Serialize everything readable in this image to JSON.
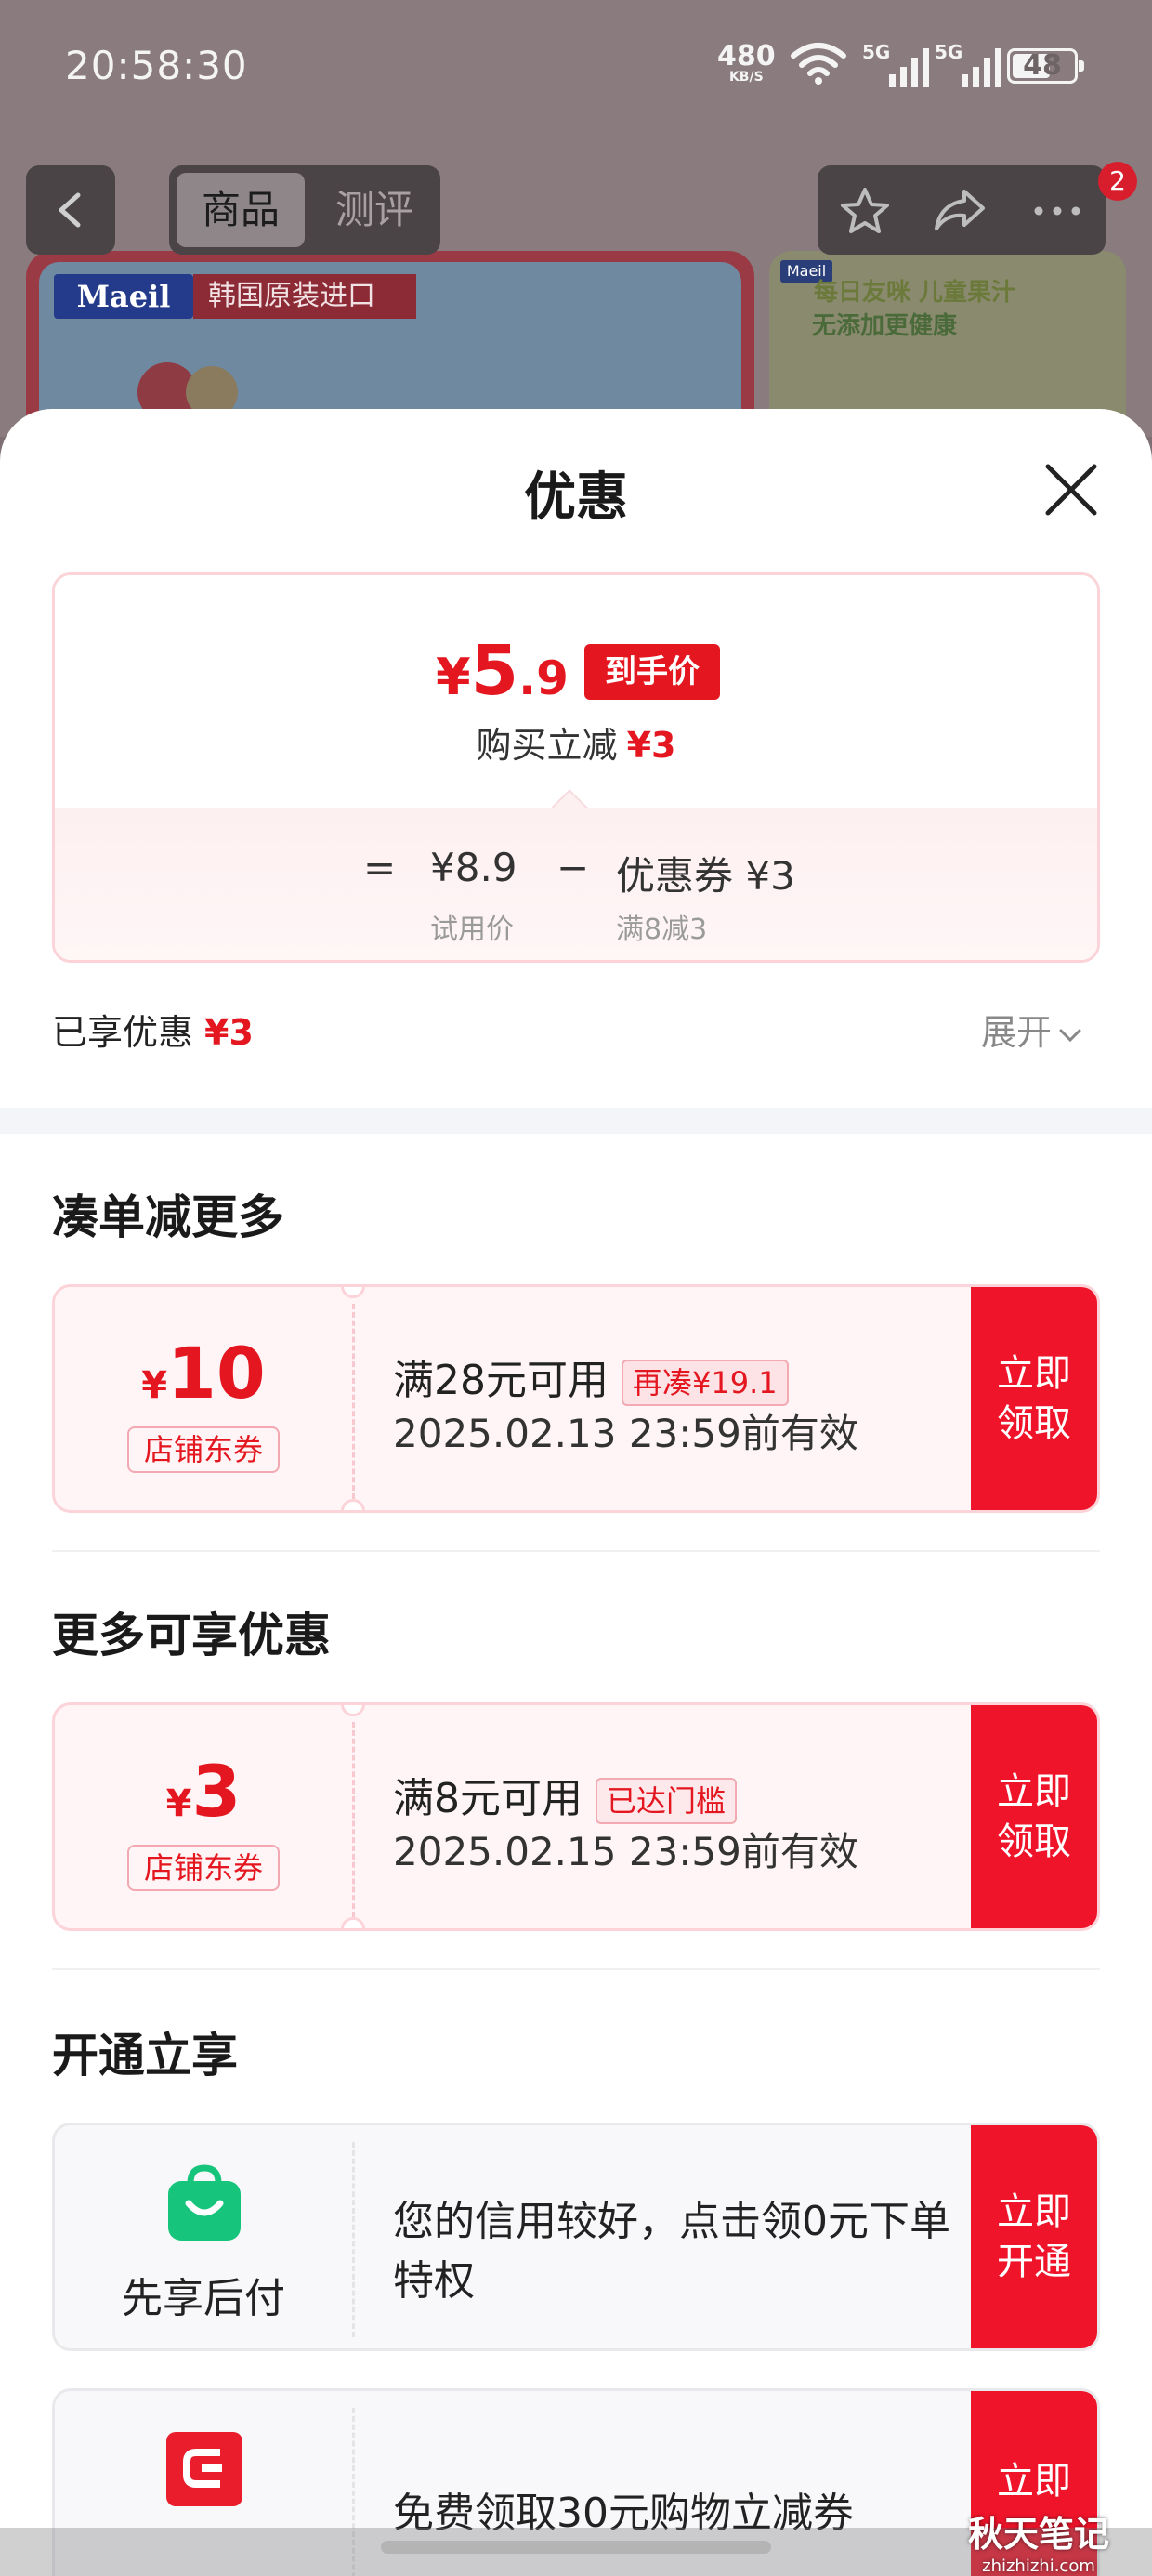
{
  "status_bar": {
    "time": "20:58:30",
    "net_speed": "480",
    "net_unit": "KB/S",
    "sim1": "5G",
    "sim2": "5G",
    "battery": "48"
  },
  "page_bg": {
    "tabs": [
      {
        "label": "商品",
        "active": true
      },
      {
        "label": "测评",
        "active": false
      }
    ],
    "cart_badge": "2",
    "banner_left": {
      "logo": "Maeil",
      "ribbon": "韩国原装进口"
    },
    "banner_right": {
      "logo": "Maeil",
      "line1": "每日友咪 儿童果汁",
      "line2": "无添加更健康"
    }
  },
  "sheet": {
    "title": "优惠",
    "price_card": {
      "currency": "¥",
      "price_int": "5",
      "price_dec": ".9",
      "final_tag": "到手价",
      "reduce_label": "购买立减",
      "reduce_amount": "¥3",
      "equals": "=",
      "trial_price": "¥8.9",
      "trial_label": "试用价",
      "minus": "−",
      "coupon_part": "优惠券 ¥3",
      "coupon_rule": "满8减3"
    },
    "enjoyed_label": "已享优惠",
    "enjoyed_amount": "¥3",
    "expand_label": "展开",
    "section1_title": "凑单减更多",
    "coupon1": {
      "currency": "¥",
      "value": "10",
      "type": "店铺东券",
      "condition": "满28元可用",
      "chip": "再凑¥19.1",
      "valid": "2025.02.13 23:59前有效",
      "action": "立即领取"
    },
    "section2_title": "更多可享优惠",
    "coupon2": {
      "currency": "¥",
      "value": "3",
      "type": "店铺东券",
      "condition": "满8元可用",
      "chip": "已达门槛",
      "valid": "2025.02.15 23:59前有效",
      "action": "立即领取"
    },
    "section3_title": "开通立享",
    "open1": {
      "icon": "shopping-bag-icon",
      "name": "先享后付",
      "desc": "您的信用较好，点击领0元下单特权",
      "action": "立即开通"
    },
    "open2": {
      "icon": "card-icon",
      "desc": "免费领取30元购物立减券",
      "action": "立即"
    }
  },
  "watermark": {
    "line1": "秋天笔记",
    "line2": "zhizhizhi.com"
  },
  "colors": {
    "accent": "#e4161f",
    "action": "#f0142b",
    "green": "#16c47c"
  }
}
